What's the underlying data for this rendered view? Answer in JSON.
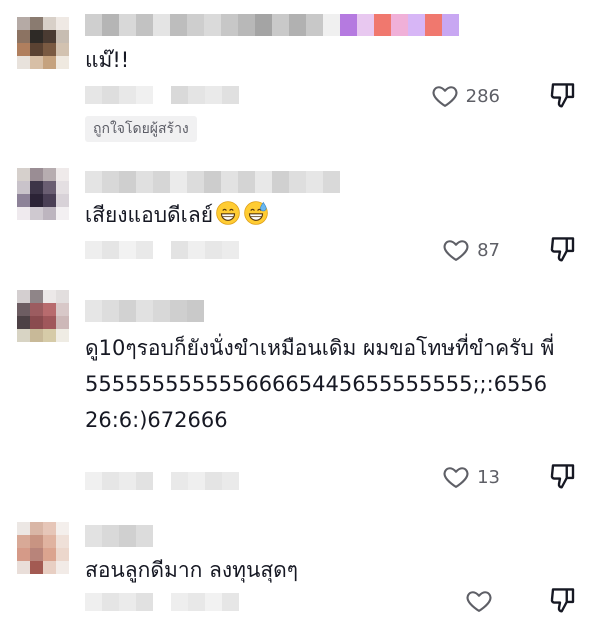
{
  "comments": [
    {
      "text": "แม๊!!",
      "likes": "286",
      "creator_tag": "ถูกใจโดยผู้สร้าง",
      "avatar_colors": [
        "#b5aaa5",
        "#8a7b70",
        "#d8d0c8",
        "#efe9e4",
        "#8c7362",
        "#2e2a26",
        "#4a3b32",
        "#c7bdb2",
        "#b07f5e",
        "#5a4232",
        "#7a5a42",
        "#d2c2b0",
        "#e8e2dc",
        "#d7bfa6",
        "#c5a27e",
        "#efe9e0"
      ],
      "name_colors": [
        "#cfcfcf",
        "#b5b5b5",
        "#d8d8d8",
        "#c2c2c2",
        "#e4e4e4",
        "#bdbdbd",
        "#cecece",
        "#dadada",
        "#c7c7c7",
        "#b8b8b8",
        "#a4a4a4",
        "#c9c9c9",
        "#b1b1b1",
        "#c8c8c8",
        "#f0f0f0",
        "#b57ae0",
        "#e8c8f0",
        "#f0786e",
        "#f0b0d8",
        "#d7b6f6",
        "#f0786e",
        "#c8a7f2"
      ],
      "meta_colors": [
        "#e6e6e6",
        "#dedede",
        "#e8e8e8",
        "#f0f0f0",
        "#d9d9d9",
        "#e4e4e4",
        "#eaeaea",
        "#e0e0e0"
      ]
    },
    {
      "text": "เสียงแอบดีเลย์",
      "likes": "87",
      "emojis": [
        "grinning-face-emoji",
        "grinning-sweat-emoji"
      ],
      "avatar_colors": [
        "#d6d0cc",
        "#9a8d94",
        "#b7adb0",
        "#efeaea",
        "#c9c3ca",
        "#3d3548",
        "#6a5e72",
        "#e4dfe2",
        "#8d8298",
        "#2b2336",
        "#4a3f55",
        "#d8d2d8",
        "#efeaee",
        "#cfc9d0",
        "#bdb5bf",
        "#f3f0f2"
      ],
      "name_colors": [
        "#e4e4e4",
        "#d8d8d8",
        "#cfcfcf",
        "#e0e0e0",
        "#d6d6d6",
        "#ebebeb",
        "#dcdcdc",
        "#cdcdcd",
        "#e2e2e2",
        "#d4d4d4",
        "#e8e8e8",
        "#d0d0d0",
        "#dedede",
        "#e6e6e6",
        "#d9d9d9"
      ],
      "meta_colors": [
        "#eeeeee",
        "#e5e5e5",
        "#f2f2f2",
        "#e9e9e9",
        "#e3e3e3",
        "#efefef",
        "#e7e7e7",
        "#ececec"
      ]
    },
    {
      "text": "ดู10ๆรอบก็ยังนั่งขำเหมือนเดิม ผมขอโทษที่ขำครับ พี่55555555555566665445655555555;;:655626:6:)672666",
      "likes": "13",
      "avatar_colors": [
        "#d4cfd0",
        "#8f8588",
        "#ece8e8",
        "#e2dede",
        "#6d5d62",
        "#9c5c60",
        "#b86b6e",
        "#d8c8c8",
        "#4d4145",
        "#8a4b4f",
        "#a0575b",
        "#cdb8b8",
        "#d8d4c4",
        "#c8b998",
        "#d6cba8",
        "#efece4"
      ],
      "name_colors": [
        "#e6e6e6",
        "#dddddd",
        "#d2d2d2",
        "#e1e1e1",
        "#d8d8d8",
        "#cfcfcf",
        "#c9c9c9"
      ],
      "meta_colors": [
        "#f0f0f0",
        "#e6e6e6",
        "#ececec",
        "#e2e2e2",
        "#e9e9e9",
        "#efefef",
        "#e4e4e4",
        "#eaeaea"
      ]
    },
    {
      "text": "สอนลูกดีมาก ลงทุนสุดๆ",
      "likes": "",
      "avatar_colors": [
        "#ece7e4",
        "#d9b6a6",
        "#e6c6b8",
        "#f4efec",
        "#d8a997",
        "#c89482",
        "#e0b3a0",
        "#efe0d8",
        "#d59a88",
        "#b8847a",
        "#dba48f",
        "#ecd7cc",
        "#e9ded9",
        "#a35a52",
        "#e8cfc3",
        "#f2ebe7"
      ],
      "name_colors": [
        "#e2e2e2",
        "#d9d9d9",
        "#d0d0d0",
        "#dcdcdc"
      ],
      "meta_colors": [
        "#efefef",
        "#e5e5e5",
        "#ebebeb",
        "#e1e1e1",
        "#eeeeee",
        "#e8e8e8",
        "#f2f2f2",
        "#e6e6e6"
      ]
    }
  ]
}
